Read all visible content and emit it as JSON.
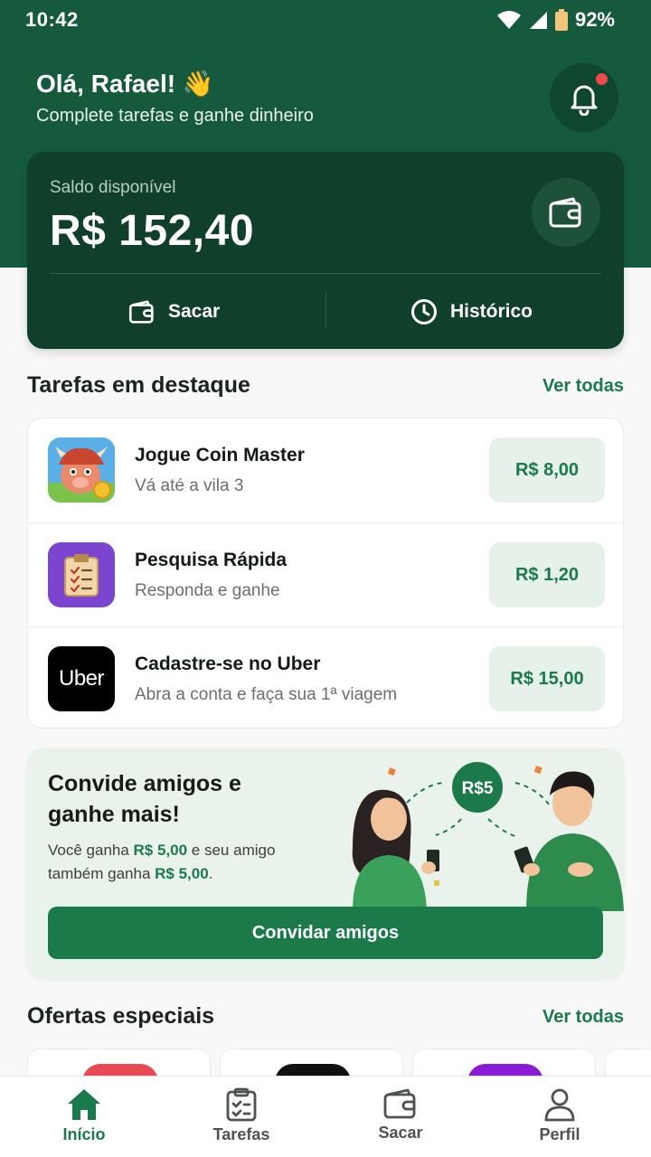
{
  "status": {
    "time": "10:42",
    "battery": "92%"
  },
  "header": {
    "greeting": "Olá, Rafael! 👋",
    "subtitle": "Complete tarefas e ganhe dinheiro"
  },
  "balance": {
    "label": "Saldo disponível",
    "value": "R$ 152,40",
    "withdraw_label": "Sacar",
    "history_label": "Histórico"
  },
  "featured": {
    "title": "Tarefas em destaque",
    "see_all": "Ver todas",
    "tasks": [
      {
        "title": "Jogue Coin Master",
        "subtitle": "Vá até a vila 3",
        "reward": "R$ 8,00",
        "icon": "coin-master-icon"
      },
      {
        "title": "Pesquisa Rápida",
        "subtitle": "Responda e ganhe",
        "reward": "R$ 1,20",
        "icon": "clipboard-icon"
      },
      {
        "title": "Cadastre-se no Uber",
        "subtitle": "Abra a conta e faça sua 1ª viagem",
        "reward": "R$ 15,00",
        "icon": "uber-icon"
      }
    ],
    "uber_logo_text": "Uber"
  },
  "invite": {
    "title": "Convide amigos e ganhe mais!",
    "desc_part1": "Você ganha ",
    "amount1": "R$ 5,00",
    "desc_part2": " e seu amigo também ganha ",
    "amount2": "R$ 5,00",
    "desc_part3": ".",
    "badge": "R$5",
    "button": "Convidar amigos"
  },
  "offers": {
    "title": "Ofertas especiais",
    "see_all": "Ver todas"
  },
  "nav": [
    {
      "label": "Início",
      "icon": "home-icon",
      "active": true
    },
    {
      "label": "Tarefas",
      "icon": "clipboard-icon"
    },
    {
      "label": "Sacar",
      "icon": "wallet-icon"
    },
    {
      "label": "Perfil",
      "icon": "user-icon"
    }
  ],
  "colors": {
    "primary": "#165a3e",
    "accent": "#1a7a4c",
    "card_dark": "#103f2c",
    "notification": "#f04a4a"
  }
}
